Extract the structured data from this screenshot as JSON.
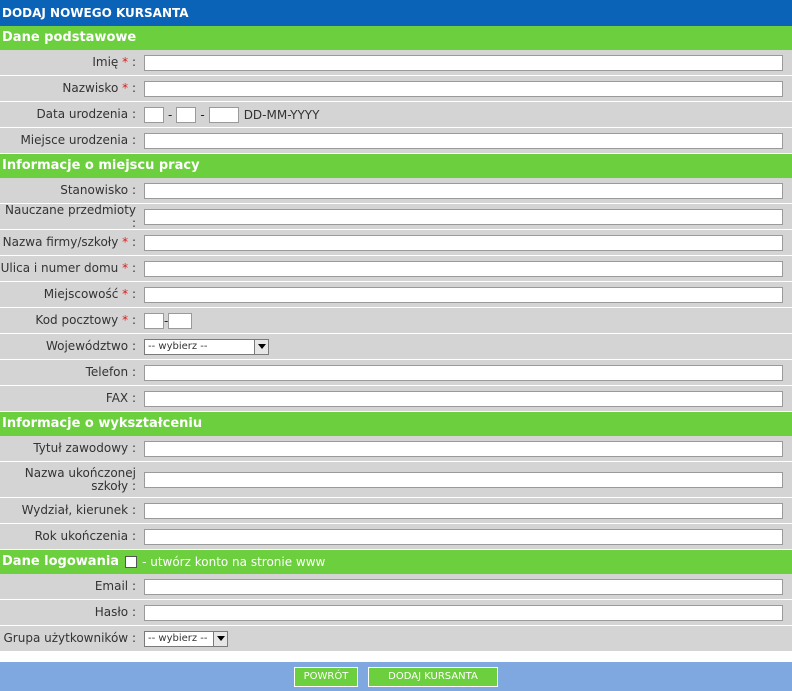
{
  "title": "DODAJ NOWEGO KURSANTA",
  "required_mark": "*",
  "colon": ":",
  "sections": {
    "basic": "Dane podstawowe",
    "work": "Informacje o miejscu pracy",
    "education": "Informacje o wykształceniu",
    "login": "Dane logowania",
    "login_note": "- utwórz konto na stronie www"
  },
  "fields": {
    "first_name": "Imię",
    "last_name": "Nazwisko",
    "birth_date": "Data urodzenia",
    "birth_date_hint": "DD-MM-YYYY",
    "date_separator": "-",
    "birth_place": "Miejsce urodzenia",
    "position": "Stanowisko",
    "subjects": "Nauczane przedmioty",
    "company": "Nazwa firmy/szkoły",
    "street": "Ulica i numer domu",
    "city": "Miejscowość",
    "postal_code": "Kod pocztowy",
    "postal_separator": "-",
    "province": "Województwo",
    "province_value": "-- wybierz --",
    "phone": "Telefon",
    "fax": "FAX",
    "title": "Tytuł zawodowy",
    "school": "Nazwa ukończonej szkoły",
    "faculty": "Wydział, kierunek",
    "grad_year": "Rok ukończenia",
    "email": "Email",
    "password": "Hasło",
    "user_group": "Grupa użytkowników",
    "user_group_value": "-- wybierz --"
  },
  "buttons": {
    "back": "POWRÓT",
    "add": "DODAJ KURSANTA"
  }
}
